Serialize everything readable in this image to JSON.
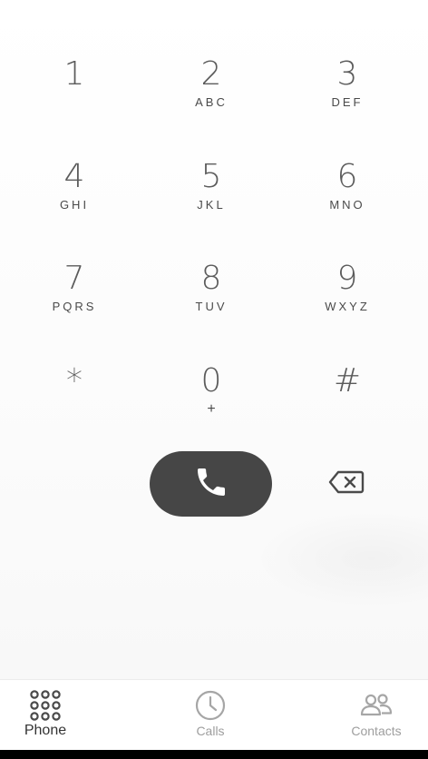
{
  "keypad": {
    "keys": [
      {
        "digit": "1",
        "letters": ""
      },
      {
        "digit": "2",
        "letters": "ABC"
      },
      {
        "digit": "3",
        "letters": "DEF"
      },
      {
        "digit": "4",
        "letters": "GHI"
      },
      {
        "digit": "5",
        "letters": "JKL"
      },
      {
        "digit": "6",
        "letters": "MNO"
      },
      {
        "digit": "7",
        "letters": "PQRS"
      },
      {
        "digit": "8",
        "letters": "TUV"
      },
      {
        "digit": "9",
        "letters": "WXYZ"
      },
      {
        "digit": "*",
        "letters": ""
      },
      {
        "digit": "0",
        "letters": "+"
      },
      {
        "digit": "#",
        "letters": ""
      }
    ]
  },
  "actions": {
    "call_icon": "phone-icon",
    "backspace_icon": "backspace-icon",
    "call_button_color": "#464646"
  },
  "bottom_nav": {
    "items": [
      {
        "label": "Phone",
        "icon": "dialpad-icon",
        "active": true
      },
      {
        "label": "Calls",
        "icon": "clock-icon",
        "active": false
      },
      {
        "label": "Contacts",
        "icon": "contacts-icon",
        "active": false
      }
    ]
  },
  "colors": {
    "background": "#ffffff",
    "digit_text": "#5b5b5b",
    "active_nav": "#333333",
    "inactive_nav": "#9e9e9e"
  }
}
